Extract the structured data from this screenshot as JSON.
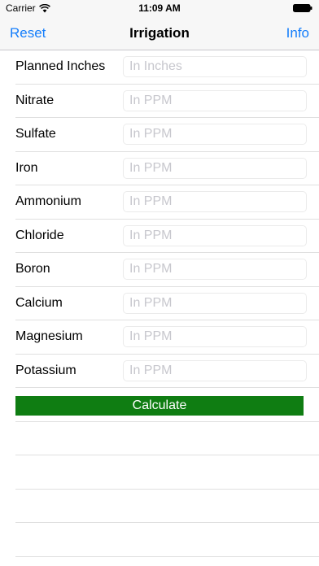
{
  "status_bar": {
    "carrier": "Carrier",
    "time": "11:09 AM",
    "wifi_icon": "wifi-icon",
    "battery_icon": "battery-full-icon"
  },
  "nav": {
    "left_label": "Reset",
    "title": "Irrigation",
    "right_label": "Info",
    "accent_color": "#157efb"
  },
  "form": {
    "rows": [
      {
        "label": "Planned Inches",
        "placeholder": "In Inches",
        "value": ""
      },
      {
        "label": "Nitrate",
        "placeholder": "In PPM",
        "value": ""
      },
      {
        "label": "Sulfate",
        "placeholder": "In PPM",
        "value": ""
      },
      {
        "label": "Iron",
        "placeholder": "In PPM",
        "value": ""
      },
      {
        "label": "Ammonium",
        "placeholder": "In PPM",
        "value": ""
      },
      {
        "label": "Chloride",
        "placeholder": "In PPM",
        "value": ""
      },
      {
        "label": "Boron",
        "placeholder": "In PPM",
        "value": ""
      },
      {
        "label": "Calcium",
        "placeholder": "In PPM",
        "value": ""
      },
      {
        "label": "Magnesium",
        "placeholder": "In PPM",
        "value": ""
      },
      {
        "label": "Potassium",
        "placeholder": "In PPM",
        "value": ""
      }
    ],
    "calculate_label": "Calculate",
    "calculate_color": "#0f7d12"
  }
}
